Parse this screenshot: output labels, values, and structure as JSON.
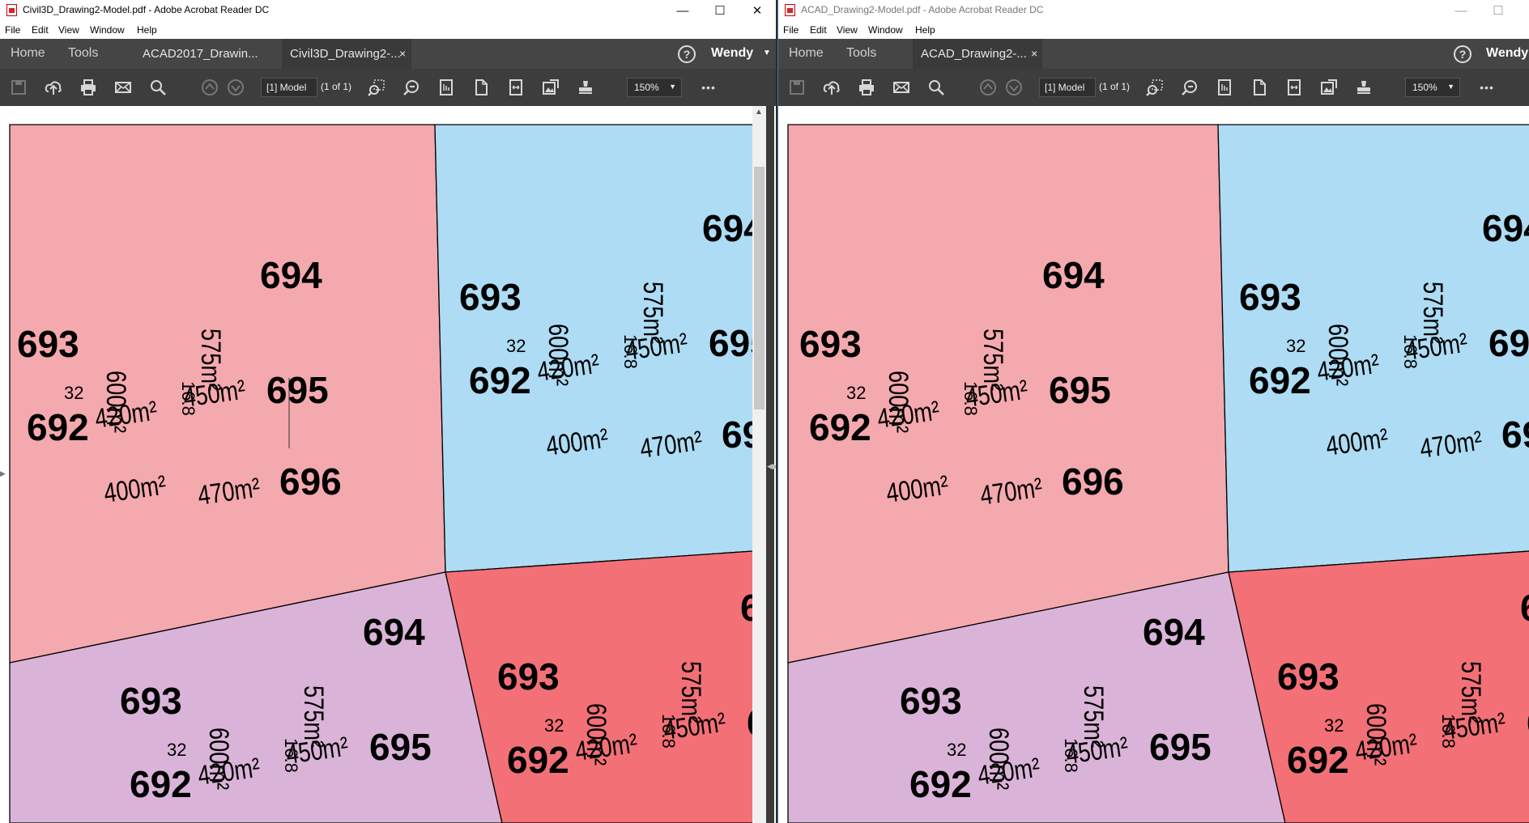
{
  "windows": [
    {
      "title": "Civil3D_Drawing2-Model.pdf - Adobe Acrobat Reader DC",
      "menu": [
        "File",
        "Edit",
        "View",
        "Window",
        "Help"
      ],
      "nav": {
        "home": "Home",
        "tools": "Tools"
      },
      "tabs": [
        {
          "label": "ACAD2017_Drawin...",
          "active": false
        },
        {
          "label": "Civil3D_Drawing2-...",
          "active": true
        }
      ],
      "tab_close": "×",
      "help": "?",
      "user": "Wendy",
      "page_field": "[1] Model",
      "page_of": "(1 of 1)",
      "zoom": "150%",
      "more": "•••"
    },
    {
      "title": "ACAD_Drawing2-Model.pdf - Adobe Acrobat Reader DC",
      "menu": [
        "File",
        "Edit",
        "View",
        "Window",
        "Help"
      ],
      "nav": {
        "home": "Home",
        "tools": "Tools"
      },
      "tabs": [
        {
          "label": "ACAD_Drawing2-...",
          "active": true
        }
      ],
      "tab_close": "×",
      "help": "?",
      "user": "Wendy",
      "page_field": "[1] Model",
      "page_of": "(1 of 1)",
      "zoom": "150%",
      "more": "•••"
    }
  ],
  "drawing": {
    "colors": {
      "pink": "#f4a9ae",
      "blue": "#addcf4",
      "purple": "#dab4d8",
      "red": "#f27076"
    },
    "lots": {
      "l693": "693",
      "l692": "692",
      "l694": "694",
      "l695": "695",
      "l696": "696"
    },
    "areas": {
      "a600": "600m²",
      "a575": "575m²",
      "a420": "420m²",
      "a450": "450m²",
      "a400": "400m²",
      "a470": "470m²"
    },
    "dims": {
      "d168": "16.8",
      "d32": "32"
    }
  }
}
